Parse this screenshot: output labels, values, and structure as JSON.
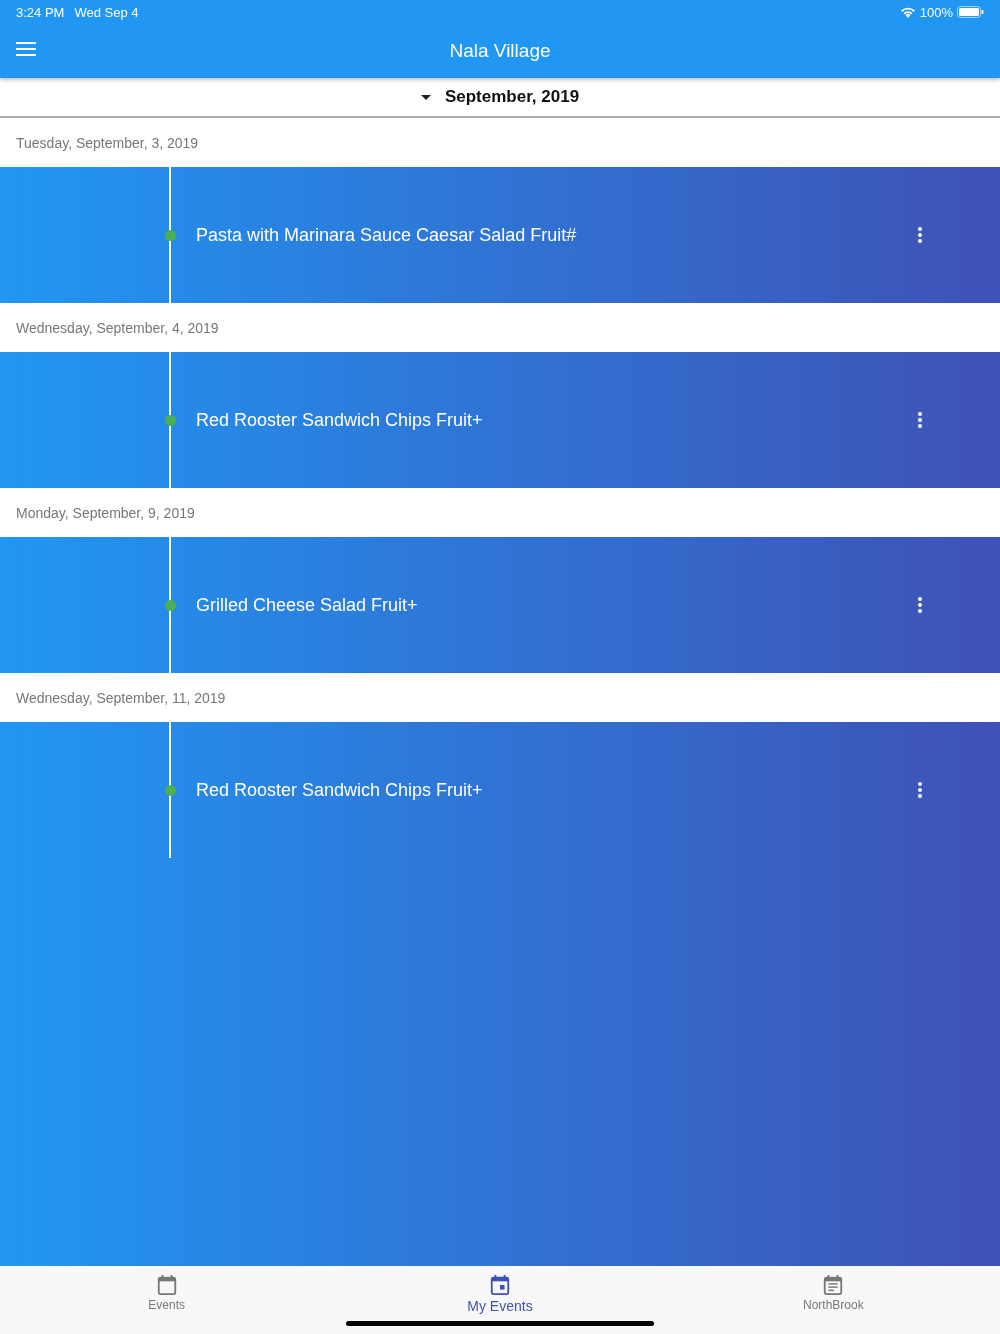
{
  "status_bar": {
    "time": "3:24 PM",
    "date": "Wed Sep 4",
    "battery": "100%"
  },
  "app_bar": {
    "title": "Nala Village"
  },
  "month_selector": {
    "label": "September, 2019"
  },
  "days": [
    {
      "date": "Tuesday, September, 3, 2019",
      "event": "Pasta with Marinara Sauce Caesar Salad Fruit#"
    },
    {
      "date": "Wednesday, September, 4, 2019",
      "event": "Red Rooster Sandwich Chips Fruit+"
    },
    {
      "date": "Monday, September, 9, 2019",
      "event": "Grilled Cheese Salad Fruit+"
    },
    {
      "date": "Wednesday, September, 11, 2019",
      "event": "Red Rooster Sandwich Chips Fruit+"
    }
  ],
  "tabs": [
    {
      "label": "Events",
      "kind": "calendar",
      "selected": false
    },
    {
      "label": "My Events",
      "kind": "event",
      "selected": true
    },
    {
      "label": "NorthBrook",
      "kind": "notes",
      "selected": false
    }
  ]
}
